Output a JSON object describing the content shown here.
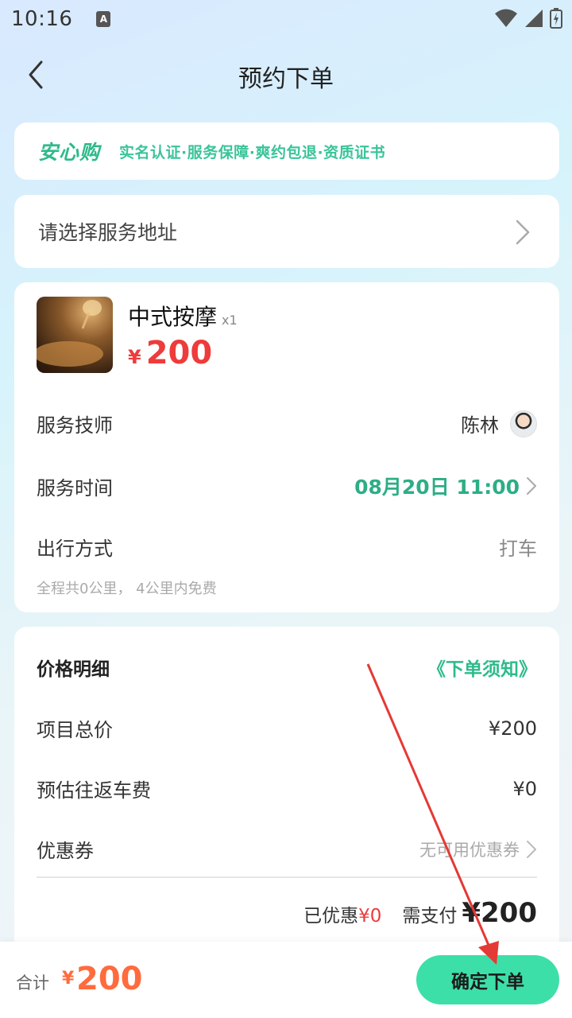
{
  "status_bar": {
    "time": "10:16",
    "notification_letter": "A"
  },
  "nav": {
    "title": "预约下单",
    "back_icon": "chevron-left-icon"
  },
  "assurance": {
    "logo": "安心购",
    "text": "实名认证·服务保障·爽约包退·资质证书"
  },
  "address": {
    "placeholder": "请选择服务地址"
  },
  "product": {
    "name": "中式按摩",
    "quantity": "x1",
    "currency": "¥",
    "price": "200"
  },
  "service_rows": {
    "technician_label": "服务技师",
    "technician_name": "陈林",
    "time_label": "服务时间",
    "time_value": "08月20日 11:00",
    "travel_label": "出行方式",
    "travel_value": "打车",
    "travel_note": "全程共0公里， 4公里内免费"
  },
  "price_detail": {
    "title": "价格明细",
    "notice_link": "《下单须知》",
    "item_total_label": "项目总价",
    "item_total_value": "¥200",
    "car_fee_label": "预估往返车费",
    "car_fee_value": "¥0",
    "coupon_label": "优惠券",
    "coupon_value": "无可用优惠券",
    "discounted_label": "已优惠",
    "discounted_value": "¥0",
    "pay_label": "需支付",
    "pay_value": "¥200"
  },
  "bottom_bar": {
    "total_label": "合计",
    "currency": "¥",
    "total_value": "200",
    "confirm_label": "确定下单"
  },
  "colors": {
    "accent_green": "#2dba8b",
    "button_green": "#3ddfa8",
    "price_red": "#ee3b3b",
    "total_orange": "#ff6b3d",
    "annotation_arrow": "#e53935"
  }
}
